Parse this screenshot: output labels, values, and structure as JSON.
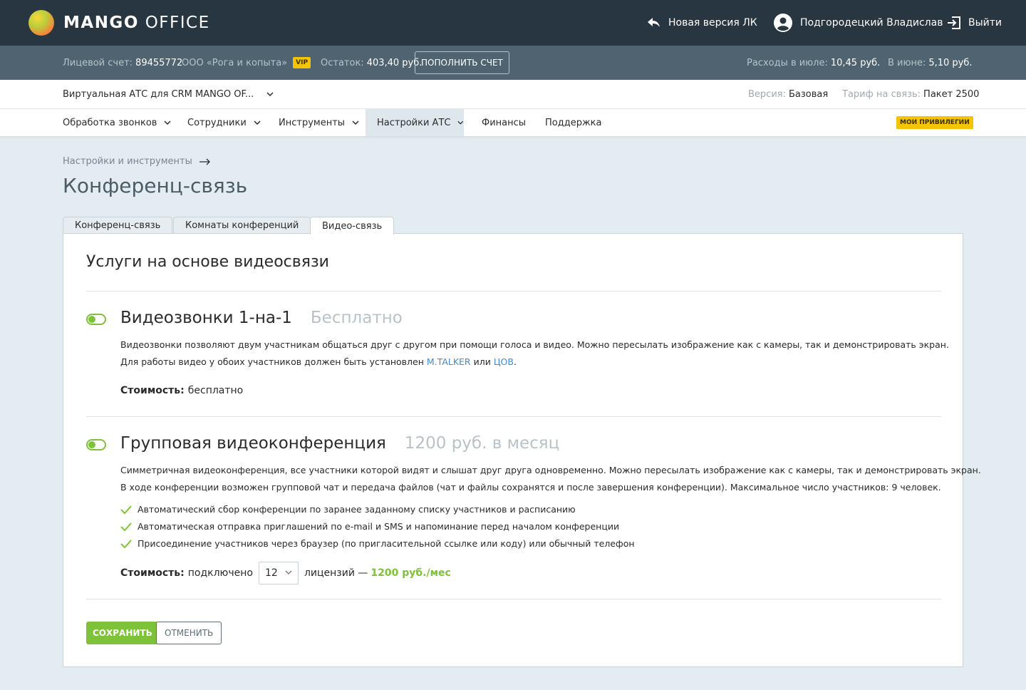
{
  "header": {
    "logo_bold": "MANGO",
    "logo_light": "OFFICE",
    "new_version": "Новая версия ЛК",
    "user_name": "Подгородецкий Владислав",
    "logout": "Выйти"
  },
  "account": {
    "account_label": "Лицевой счет:",
    "account_number": "89455772",
    "company": "ООО «Рога и копыта»",
    "vip_badge": "VIP",
    "balance_label": "Остаток:",
    "balance_value": "403,40 руб.",
    "topup_button": "ПОПОЛНИТЬ СЧЕТ",
    "july_label": "Расходы в июле:",
    "july_value": "10,45 руб.",
    "june_label": "В июне:",
    "june_value": "5,10 руб."
  },
  "product": {
    "selector": "Виртуальная АТС для CRM MANGO OF...",
    "version_label": "Версия:",
    "version_value": "Базовая",
    "tariff_label": "Тариф на связь:",
    "tariff_value": "Пакет 2500"
  },
  "nav": {
    "items": [
      {
        "label": "Обработка звонков"
      },
      {
        "label": "Сотрудники"
      },
      {
        "label": "Инструменты"
      },
      {
        "label": "Настройки АТС"
      },
      {
        "label": "Финансы"
      },
      {
        "label": "Поддержка"
      }
    ],
    "privileges_badge": "МОИ ПРИВИЛЕГИИ"
  },
  "page": {
    "breadcrumb": "Настройки и инструменты",
    "title": "Конференц-связь",
    "tabs": [
      {
        "label": "Конференц-связь"
      },
      {
        "label": "Комнаты конференций"
      },
      {
        "label": "Видео-связь"
      }
    ]
  },
  "card": {
    "title": "Услуги на основе видеосвязи",
    "service1": {
      "title": "Видеозвонки 1-на-1",
      "price": "Бесплатно",
      "desc_line1": "Видеозвонки позволяют двум участникам общаться друг с другом при помощи голоса и видео. Можно пересылать изображение как с камеры, так и демонстрировать экран.",
      "desc_line2_prefix": "Для работы видео у обоих участников должен быть установлен",
      "link1": "M.TALKER",
      "conj": "или",
      "link2": "ЦОВ",
      "dot": ".",
      "cost_label": "Стоимость:",
      "cost_value": "бесплатно"
    },
    "service2": {
      "title": "Групповая видеоконференция",
      "price": "1200 руб. в месяц",
      "desc_line1": "Симметричная видеоконференция, все участники которой видят и слышат друг друга одновременно. Можно пересылать изображение как с камеры, так и демонстрировать экран.",
      "desc_line2": "В ходе конференции возможен групповой чат и передача файлов (чат и файлы сохранятся и после завершения конференции). Максимальное число участников: 9 человек.",
      "features": [
        "Автоматический сбор конференции по заранее заданному списку участников и расписанию",
        "Автоматическая отправка приглашений по e-mail и SMS и напоминание перед началом конференции",
        "Присоединение участников через браузер (по пригласительной ссылке или коду) или обычный телефон"
      ],
      "cost_label": "Стоимость:",
      "cost_connected": "подключено",
      "licenses_value": "12",
      "licenses_label": "лицензий —",
      "licenses_price": "1200 руб./мес"
    },
    "save_button": "СОХРАНИТЬ",
    "cancel_button": "ОТМЕНИТЬ"
  },
  "colors": {
    "topbar": "#273640",
    "accbar": "#4f6470",
    "accent_green": "#7ec23a",
    "link_blue": "#3e8dd6",
    "vip_yellow": "#f4c400",
    "page_bg": "#e3ecf1"
  }
}
